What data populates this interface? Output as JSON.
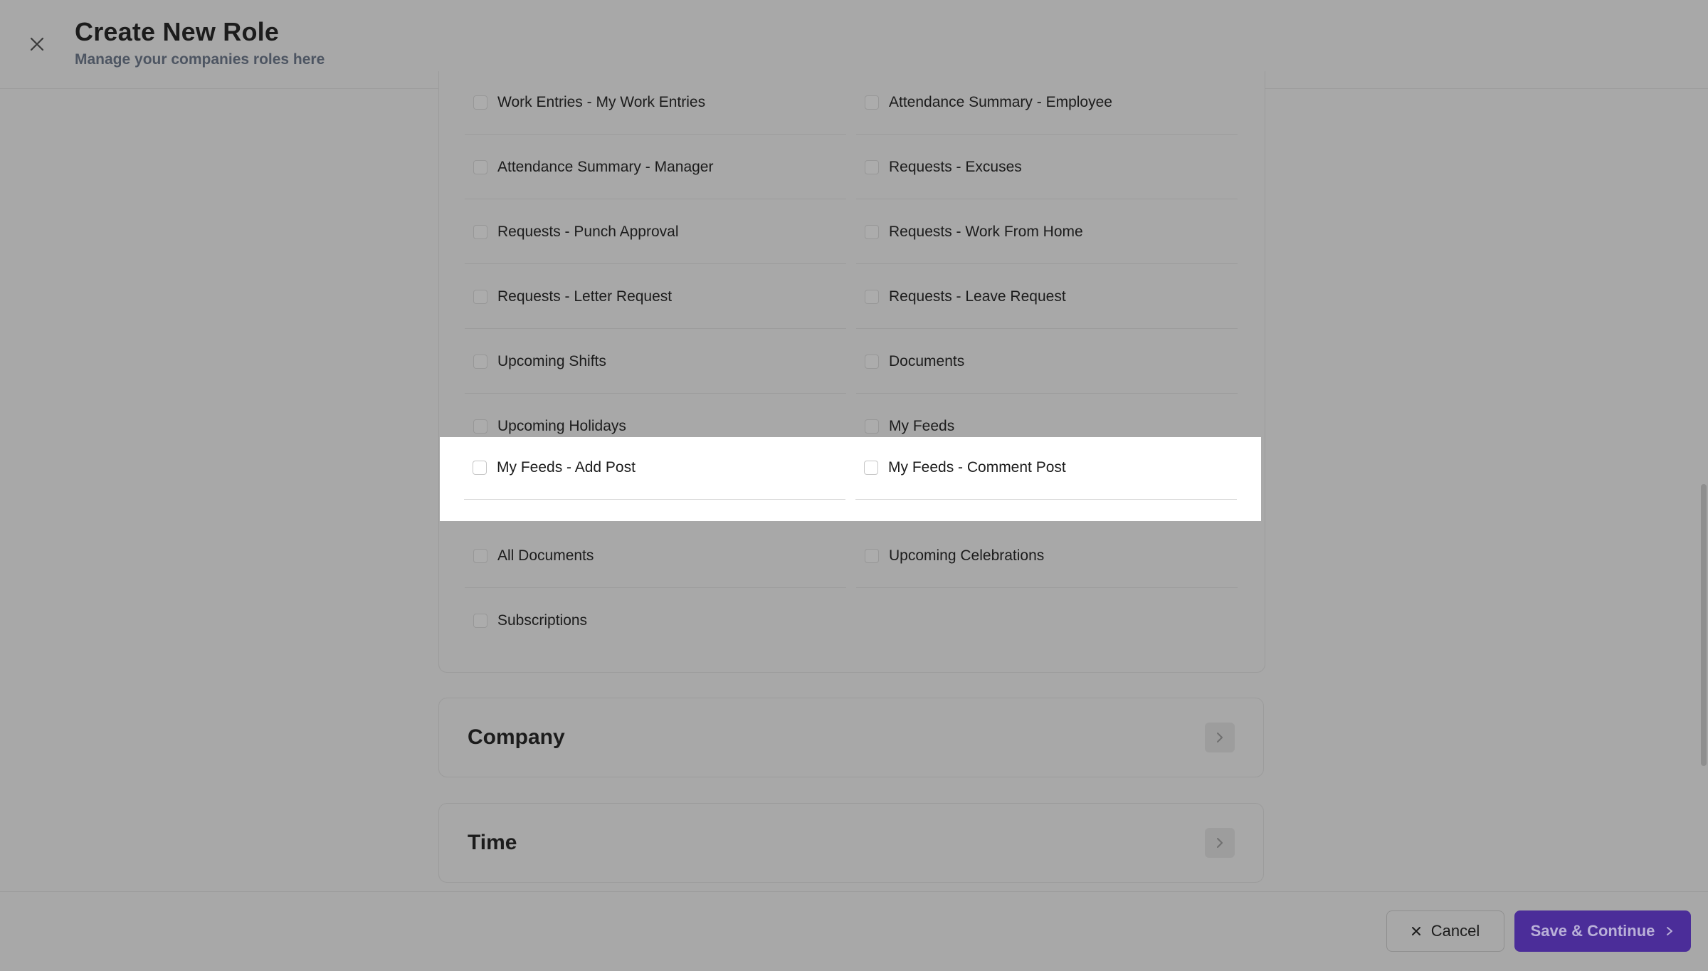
{
  "header": {
    "title": "Create New Role",
    "subtitle": "Manage your companies roles here"
  },
  "permissions": [
    [
      "Work Entries - My Work Entries",
      "Attendance Summary - Employee"
    ],
    [
      "Attendance Summary - Manager",
      "Requests - Excuses"
    ],
    [
      "Requests - Punch Approval",
      "Requests - Work From Home"
    ],
    [
      "Requests - Letter Request",
      "Requests - Leave Request"
    ],
    [
      "Upcoming Shifts",
      "Documents"
    ],
    [
      "Upcoming Holidays",
      "My Feeds"
    ],
    [
      "My Feeds - Add Post",
      "My Feeds - Comment Post"
    ],
    [
      "All Documents",
      "Upcoming Celebrations"
    ],
    [
      "Subscriptions"
    ]
  ],
  "sections": [
    {
      "title": "Company"
    },
    {
      "title": "Time"
    }
  ],
  "footer": {
    "cancel_label": "Cancel",
    "save_label": "Save & Continue"
  },
  "colors": {
    "overlay": "#a8a8a8",
    "highlight": "#ffffff",
    "primary": "#4b2d99"
  }
}
